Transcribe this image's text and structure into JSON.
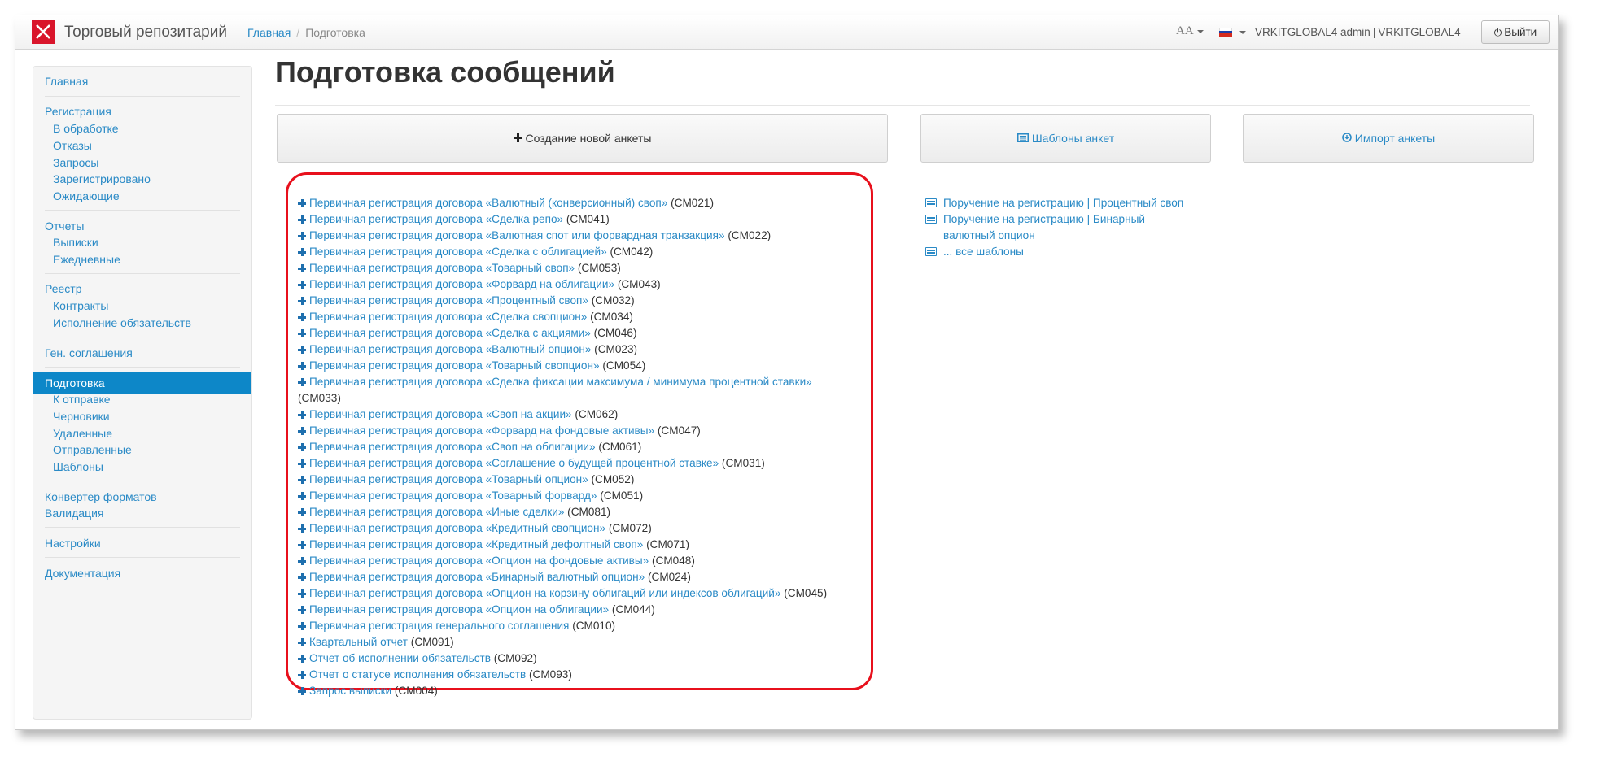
{
  "app": {
    "title": "Торговый репозитарий",
    "breadcrumb": {
      "home": "Главная",
      "current": "Подготовка"
    },
    "font_size_icon": "AA",
    "language_flag": "russian-flag",
    "user": "VRKITGLOBAL4 admin",
    "user_separator": "|",
    "org": "VRKITGLOBAL4",
    "logout_label": "Выйти"
  },
  "sidebar": {
    "home": "Главная",
    "registration": "Регистрация",
    "in_process": "В обработке",
    "rejections": "Отказы",
    "requests": "Запросы",
    "registered": "Зарегистрировано",
    "pending": "Ожидающие",
    "reports": "Отчеты",
    "statements": "Выписки",
    "daily": "Ежедневные",
    "registry": "Реестр",
    "contracts": "Контракты",
    "execution": "Исполнение обязательств",
    "general_agreements": "Ген. соглашения",
    "preparation": "Подготовка",
    "to_send": "К отправке",
    "drafts": "Черновики",
    "deleted": "Удаленные",
    "sent": "Отправленные",
    "templates": "Шаблоны",
    "format_converter": "Конвертер форматов",
    "validation": "Валидация",
    "settings": "Настройки",
    "documentation": "Документация"
  },
  "main": {
    "title": "Подготовка сообщений",
    "create_btn": "Создание новой анкеты",
    "templates_btn": "Шаблоны анкет",
    "import_btn": "Импорт анкеты"
  },
  "forms": [
    {
      "label": "Первичная регистрация договора «Валютный (конверсионный) своп»",
      "code": "(CM021)"
    },
    {
      "label": "Первичная регистрация договора «Сделка репо»",
      "code": "(CM041)"
    },
    {
      "label": "Первичная регистрация договора «Валютная спот или форвардная транзакция»",
      "code": "(CM022)"
    },
    {
      "label": "Первичная регистрация договора «Сделка с облигацией»",
      "code": "(CM042)"
    },
    {
      "label": "Первичная регистрация договора «Товарный своп»",
      "code": "(CM053)"
    },
    {
      "label": "Первичная регистрация договора «Форвард на облигации»",
      "code": "(CM043)"
    },
    {
      "label": "Первичная регистрация договора «Процентный своп»",
      "code": "(CM032)"
    },
    {
      "label": "Первичная регистрация договора «Сделка свопцион»",
      "code": "(CM034)"
    },
    {
      "label": "Первичная регистрация договора «Сделка с акциями»",
      "code": "(CM046)"
    },
    {
      "label": "Первичная регистрация договора «Валютный опцион»",
      "code": "(CM023)"
    },
    {
      "label": "Первичная регистрация договора «Товарный свопцион»",
      "code": "(CM054)"
    },
    {
      "label": "Первичная регистрация договора «Сделка фиксации максимума / минимума процентной ставки»",
      "code": "(CM033)"
    },
    {
      "label": "Первичная регистрация договора «Своп на акции»",
      "code": "(CM062)"
    },
    {
      "label": "Первичная регистрация договора «Форвард на фондовые активы»",
      "code": "(CM047)"
    },
    {
      "label": "Первичная регистрация договора «Своп на облигации»",
      "code": "(CM061)"
    },
    {
      "label": "Первичная регистрация договора «Соглашение о будущей процентной ставке»",
      "code": "(CM031)"
    },
    {
      "label": "Первичная регистрация договора «Товарный опцион»",
      "code": "(CM052)"
    },
    {
      "label": "Первичная регистрация договора «Товарный форвард»",
      "code": "(CM051)"
    },
    {
      "label": "Первичная регистрация договора «Иные сделки»",
      "code": "(CM081)"
    },
    {
      "label": "Первичная регистрация договора «Кредитный свопцион»",
      "code": "(CM072)"
    },
    {
      "label": "Первичная регистрация договора «Кредитный дефолтный своп»",
      "code": "(CM071)"
    },
    {
      "label": "Первичная регистрация договора «Опцион на фондовые активы»",
      "code": "(CM048)"
    },
    {
      "label": "Первичная регистрация договора «Бинарный валютный опцион»",
      "code": "(CM024)"
    },
    {
      "label": "Первичная регистрация договора «Опцион на корзину облигаций или индексов облигаций»",
      "code": "(CM045)"
    },
    {
      "label": "Первичная регистрация договора «Опцион на облигации»",
      "code": "(CM044)"
    },
    {
      "label": "Первичная регистрация генерального соглашения",
      "code": "(CM010)"
    },
    {
      "label": "Квартальный отчет",
      "code": "(CM091)"
    },
    {
      "label": "Отчет об исполнении обязательств",
      "code": "(CM092)"
    },
    {
      "label": "Отчет о статусе исполнения обязательств",
      "code": "(CM093)"
    },
    {
      "label": "Запрос выписки",
      "code": "(CM004)"
    }
  ],
  "templates": {
    "t1": "Поручение на регистрацию | Процентный своп",
    "t2_line1": "Поручение на регистрацию | Бинарный",
    "t2_line2": "валютный опцион",
    "all": "... все шаблоны"
  }
}
